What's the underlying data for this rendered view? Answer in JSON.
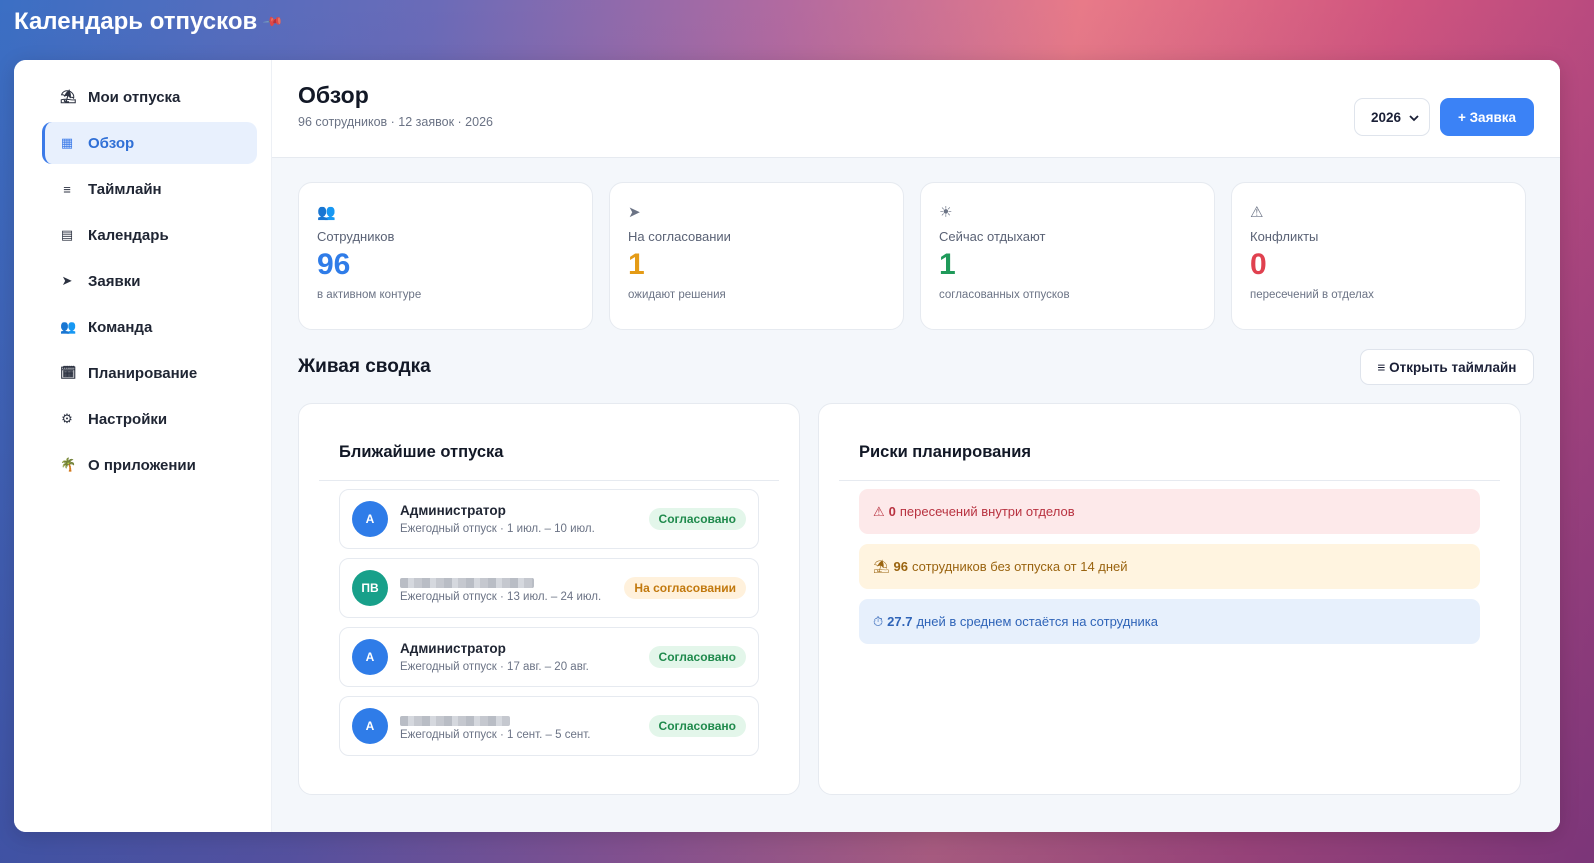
{
  "app": {
    "title": "Календарь отпусков",
    "pin_icon": "pin-icon"
  },
  "sidebar": {
    "items": [
      {
        "label": "Мои отпуска",
        "icon": "⛱"
      },
      {
        "label": "Обзор",
        "icon": "▦"
      },
      {
        "label": "Таймлайн",
        "icon": "≡"
      },
      {
        "label": "Календарь",
        "icon": "▤"
      },
      {
        "label": "Заявки",
        "icon": "➤"
      },
      {
        "label": "Команда",
        "icon": "👥"
      },
      {
        "label": "Планирование",
        "icon": "🗓"
      },
      {
        "label": "Настройки",
        "icon": "⚙"
      },
      {
        "label": "О приложении",
        "icon": "🌴"
      }
    ],
    "active_index": 1
  },
  "header": {
    "title": "Обзор",
    "subtitle": "96 сотрудников · 12 заявок · 2026",
    "year": "2026",
    "new_request_label": "+ Заявка"
  },
  "stats": [
    {
      "icon": "👥",
      "label": "Сотрудников",
      "value": "96",
      "note": "в активном контуре",
      "color": "#2f7ce8"
    },
    {
      "icon": "➤",
      "label": "На согласовании",
      "value": "1",
      "note": "ожидают решения",
      "color": "#e49b16"
    },
    {
      "icon": "☀",
      "label": "Сейчас отдыхают",
      "value": "1",
      "note": "согласованных отпусков",
      "color": "#1f9a5a"
    },
    {
      "icon": "⚠",
      "label": "Конфликты",
      "value": "0",
      "note": "пересечений в отделах",
      "color": "#e0414f"
    }
  ],
  "summary": {
    "title": "Живая сводка",
    "open_timeline_label": "≡ Открыть таймлайн"
  },
  "upcoming": {
    "title": "Ближайшие отпуска",
    "items": [
      {
        "initials": "А",
        "name": "Администратор",
        "meta": "Ежегодный отпуск · 1 июл. – 10 июл.",
        "status": "Согласовано",
        "avatar_color": "#2f7ce8"
      },
      {
        "initials": "ПВ",
        "name": "",
        "meta": "Ежегодный отпуск · 13 июл. – 24 июл.",
        "status": "На согласовании",
        "avatar_color": "#18a08a"
      },
      {
        "initials": "А",
        "name": "Администратор",
        "meta": "Ежегодный отпуск · 17 авг. – 20 авг.",
        "status": "Согласовано",
        "avatar_color": "#2f7ce8"
      },
      {
        "initials": "А",
        "name": "",
        "meta": "Ежегодный отпуск · 1 сент. – 5 сент.",
        "status": "Согласовано",
        "avatar_color": "#2f7ce8"
      }
    ]
  },
  "risks": {
    "title": "Риски планирования",
    "items": [
      {
        "icon": "⚠",
        "value": "0",
        "text": "пересечений внутри отделов"
      },
      {
        "icon": "⛱",
        "value": "96",
        "text": "сотрудников без отпуска от 14 дней"
      },
      {
        "icon": "⏱",
        "value": "27.7",
        "text": "дней в среднем остаётся на сотрудника"
      }
    ]
  }
}
